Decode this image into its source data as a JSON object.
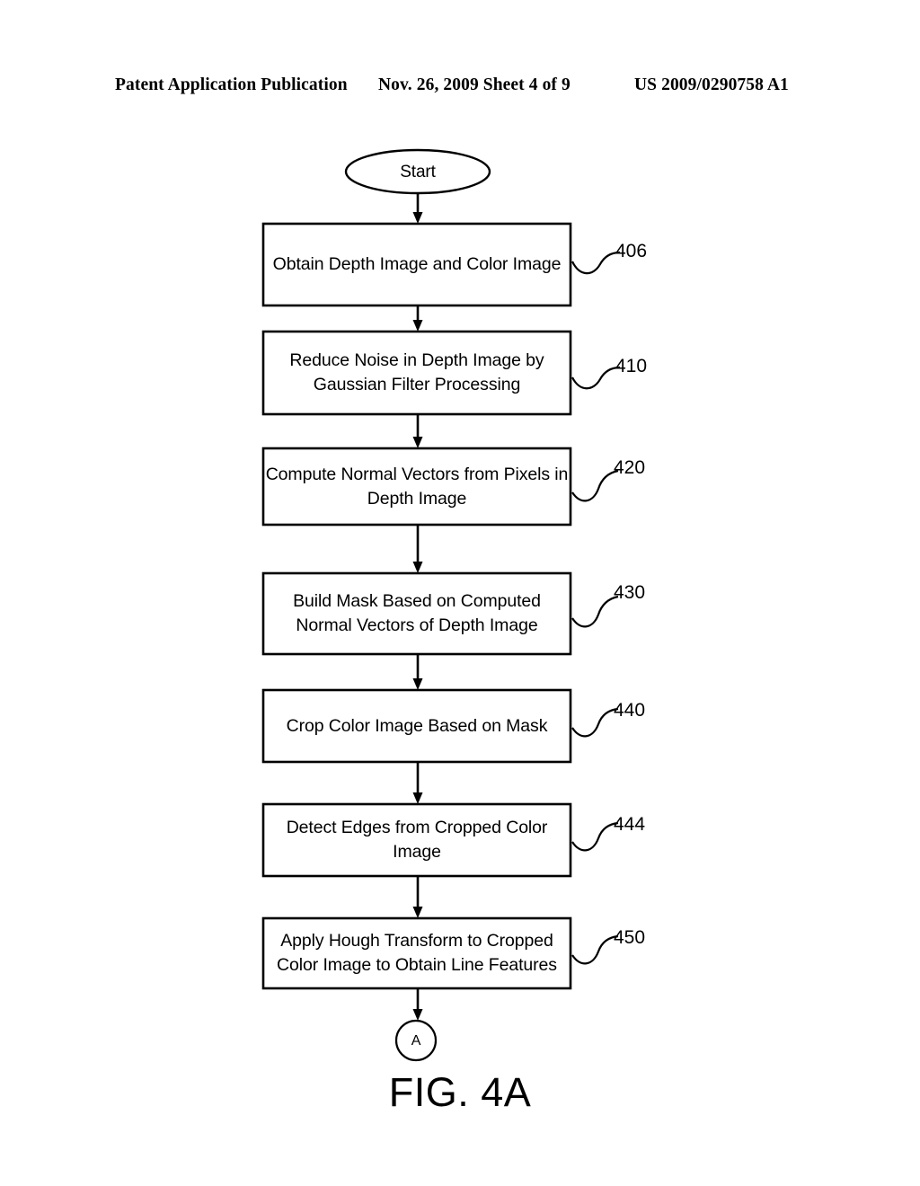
{
  "header": {
    "left": "Patent Application Publication",
    "middle": "Nov. 26, 2009  Sheet 4 of 9",
    "right": "US 2009/0290758 A1"
  },
  "figure": {
    "caption": "FIG. 4A",
    "start_node": {
      "label": "Start",
      "shape": "ellipse"
    },
    "end_connector": {
      "label": "A",
      "shape": "circle"
    },
    "steps": [
      {
        "ref": "406",
        "text": "Obtain Depth Image and Color Image",
        "lines": [
          "Obtain Depth Image and Color Image"
        ]
      },
      {
        "ref": "410",
        "text": "Reduce Noise in Depth Image by Gaussian Filter Processing",
        "lines": [
          "Reduce Noise in Depth Image by",
          "Gaussian Filter Processing"
        ]
      },
      {
        "ref": "420",
        "text": "Compute Normal Vectors from Pixels in Depth Image",
        "lines": [
          "Compute Normal Vectors from Pixels in",
          "Depth Image"
        ]
      },
      {
        "ref": "430",
        "text": "Build Mask Based on Computed Normal Vectors of Depth Image",
        "lines": [
          "Build Mask Based on Computed",
          "Normal Vectors of Depth Image"
        ]
      },
      {
        "ref": "440",
        "text": "Crop Color Image Based on Mask",
        "lines": [
          "Crop Color Image Based on Mask"
        ]
      },
      {
        "ref": "444",
        "text": "Detect Edges from Cropped Color Image",
        "lines": [
          "Detect Edges from Cropped Color",
          "Image"
        ]
      },
      {
        "ref": "450",
        "text": "Apply Hough Transform to Cropped Color Image to Obtain Line Features",
        "lines": [
          "Apply Hough Transform to Cropped",
          "Color Image to Obtain Line Features"
        ]
      }
    ]
  },
  "colors": {
    "ink": "#000000",
    "paper": "#ffffff"
  }
}
